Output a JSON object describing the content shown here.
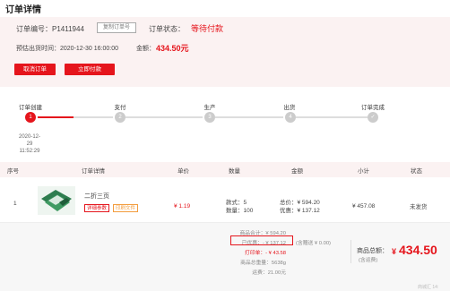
{
  "page_title": "订单详情",
  "order": {
    "number_label": "订单编号：",
    "number": "P1411944",
    "copy_button": "复制订单号",
    "status_label": "订单状态：",
    "status": "等待付款",
    "ship_time_label": "预估出货时间：",
    "ship_time": "2020-12-30 16:00:00",
    "amount_label": "金额：",
    "amount": "434.50元",
    "cancel_button": "取消订单",
    "pay_button": "立即付款"
  },
  "steps": [
    {
      "label": "订单创建",
      "marker": "1",
      "active": true
    },
    {
      "label": "支付",
      "marker": "2",
      "active": false
    },
    {
      "label": "生产",
      "marker": "3",
      "active": false
    },
    {
      "label": "出货",
      "marker": "4",
      "active": false
    },
    {
      "label": "订单完成",
      "marker": "✓",
      "active": false
    }
  ],
  "step_time": {
    "date": "2020-12-29",
    "time": "11:52:29"
  },
  "table": {
    "headers": [
      "序号",
      "订单详情",
      "单价",
      "数量",
      "金额",
      "小计",
      "状态"
    ],
    "rows": [
      {
        "index": "1",
        "name": "二折三页",
        "tag_detail": "详细参数",
        "tag_file": "印刷文件",
        "unit_price": "¥ 1.19",
        "style_label": "款式：",
        "style_val": "5",
        "qty_label": "数量：",
        "qty_val": "100",
        "total_label": "总价：",
        "total_val": "¥ 594.20",
        "discount_label": "优惠：",
        "discount_val": "¥ 137.12",
        "subtotal": "¥ 457.08",
        "status": "未发货"
      }
    ]
  },
  "summary": {
    "goods_total": "商品合计：¥ 594.20",
    "discount": "已优惠：- ¥ 137.12",
    "coupon": "(含赠送 ¥ 0.00)",
    "extra_discount": "打印单：- ¥ 43.58",
    "weight": "商品总重量：5638g",
    "shipping": "运费：21.00元",
    "total_label": "商品总额：",
    "total_note": "(含运费)",
    "total_currency": "¥",
    "total_value": "434.50",
    "corner_note": "商城汇 14:"
  },
  "colors": {
    "accent": "#e5151c",
    "light_bg": "#fbf2f2"
  }
}
